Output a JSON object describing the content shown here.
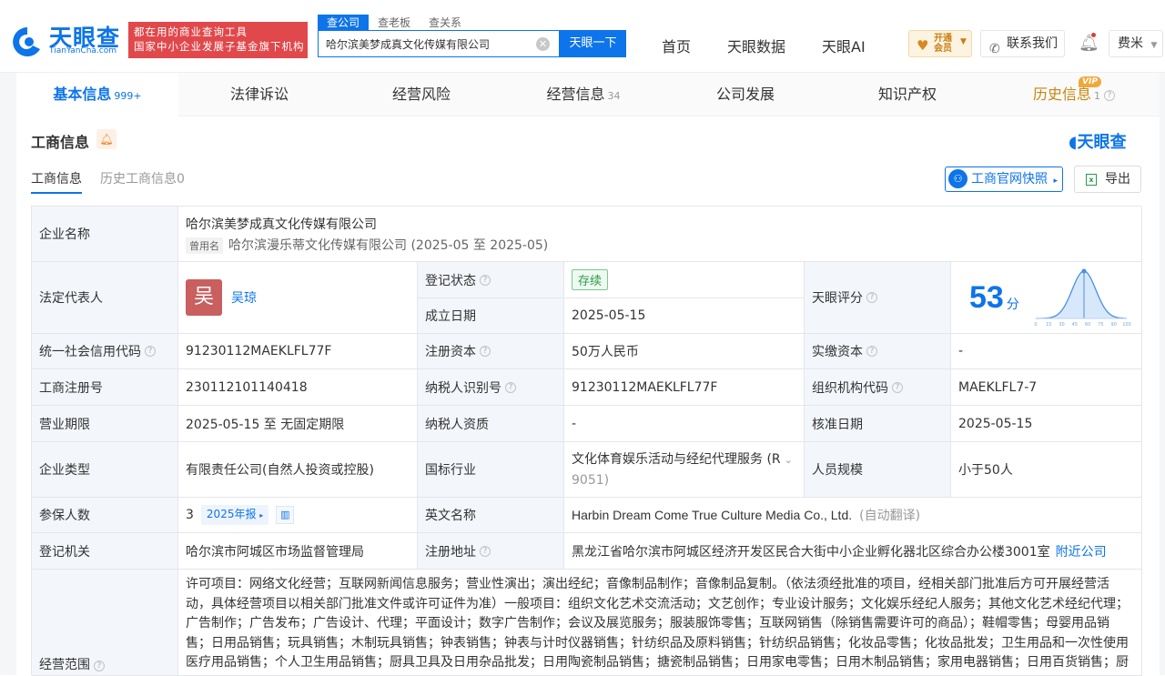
{
  "header": {
    "logo_cn": "天眼查",
    "logo_en": "TianYanCha.com",
    "slogan_line1": "都在用的商业查询工具",
    "slogan_line2": "国家中小企业发展子基金旗下机构",
    "search_tabs": [
      "查公司",
      "查老板",
      "查关系"
    ],
    "search_value": "哈尔滨美梦成真文化传媒有限公司",
    "search_button": "天眼一下",
    "nav": [
      "首页",
      "天眼数据",
      "天眼AI"
    ],
    "vip_label_1": "开通",
    "vip_label_2": "会员",
    "contact": "联系我们",
    "user": "费米"
  },
  "main_tabs": [
    {
      "label": "基本信息",
      "count": "999+"
    },
    {
      "label": "法律诉讼",
      "count": ""
    },
    {
      "label": "经营风险",
      "count": ""
    },
    {
      "label": "经营信息",
      "count": "34"
    },
    {
      "label": "公司发展",
      "count": ""
    },
    {
      "label": "知识产权",
      "count": ""
    },
    {
      "label": "历史信息",
      "count": "1"
    }
  ],
  "vip_tag": "VIP",
  "section": {
    "title": "工商信息",
    "brand": "天眼查",
    "subtabs": [
      "工商信息",
      "历史工商信息0"
    ],
    "snapshot_button": "工商官网快照",
    "export_button": "导出"
  },
  "info": {
    "company_name_label": "企业名称",
    "company_name": "哈尔滨美梦成真文化传媒有限公司",
    "former_name_tag": "曾用名",
    "former_name": "哈尔滨漫乐蒂文化传媒有限公司 (2025-05 至 2025-05)",
    "legal_rep_label": "法定代表人",
    "legal_rep_avatar": "吴",
    "legal_rep": "吴琼",
    "reg_status_label": "登记状态",
    "reg_status": "存续",
    "founded_label": "成立日期",
    "founded": "2025-05-15",
    "score_label": "天眼评分",
    "score": "53",
    "score_unit": "分",
    "credit_code_label": "统一社会信用代码",
    "credit_code": "91230112MAEKLFL77F",
    "reg_capital_label": "注册资本",
    "reg_capital": "50万人民币",
    "paid_capital_label": "实缴资本",
    "paid_capital": "-",
    "reg_no_label": "工商注册号",
    "reg_no": "230112101140418",
    "taxpayer_id_label": "纳税人识别号",
    "taxpayer_id": "91230112MAEKLFL77F",
    "org_code_label": "组织机构代码",
    "org_code": "MAEKLFL7-7",
    "term_label": "营业期限",
    "term": "2025-05-15 至 无固定期限",
    "taxpayer_qual_label": "纳税人资质",
    "taxpayer_qual": "-",
    "approve_date_label": "核准日期",
    "approve_date": "2025-05-15",
    "type_label": "企业类型",
    "type": "有限责任公司(自然人投资或控股)",
    "industry_label": "国标行业",
    "industry_line1": "文化体育娱乐活动与经纪代理服务 (R",
    "industry_line2": "9051)",
    "staff_label": "人员规模",
    "staff": "小于50人",
    "insured_label": "参保人数",
    "insured": "3",
    "insured_year": "2025年报",
    "en_name_label": "英文名称",
    "en_name": "Harbin Dream Come True Culture Media Co., Ltd.",
    "en_name_note": "(自动翻译)",
    "authority_label": "登记机关",
    "authority": "哈尔滨市阿城区市场监督管理局",
    "address_label": "注册地址",
    "address": "黑龙江省哈尔滨市阿城区经济开发区民合大街中小企业孵化器北区综合办公楼3001室",
    "nearby": "附近公司",
    "scope_label": "经营范围",
    "scope": "许可项目：网络文化经营；互联网新闻信息服务；营业性演出；演出经纪；音像制品制作；音像制品复制。（依法须经批准的项目，经相关部门批准后方可开展经营活动，具体经营项目以相关部门批准文件或许可证件为准）一般项目：组织文化艺术交流活动；文艺创作；专业设计服务；文化娱乐经纪人服务；其他文化艺术经纪代理；广告制作；广告发布；广告设计、代理；平面设计；数字广告制作；会议及展览服务；服装服饰零售；互联网销售（除销售需要许可的商品）；鞋帽零售；母婴用品销售；日用品销售；玩具销售；木制玩具销售；钟表销售；钟表与计时仪器销售；针纺织品及原料销售；针纺织品销售；化妆品零售；化妆品批发；卫生用品和一次性使用医疗用品销售；个人卫生用品销售；厨具卫具及日用杂品批发；日用陶瓷制品销售；搪瓷制品销售；日用家电零售；日用木制品销售；家用电器销售；日用百货销售；厨"
  },
  "score_chart": {
    "ticks": [
      "0",
      "15",
      "30",
      "45",
      "60",
      "75",
      "90",
      "100"
    ],
    "score": 53
  }
}
